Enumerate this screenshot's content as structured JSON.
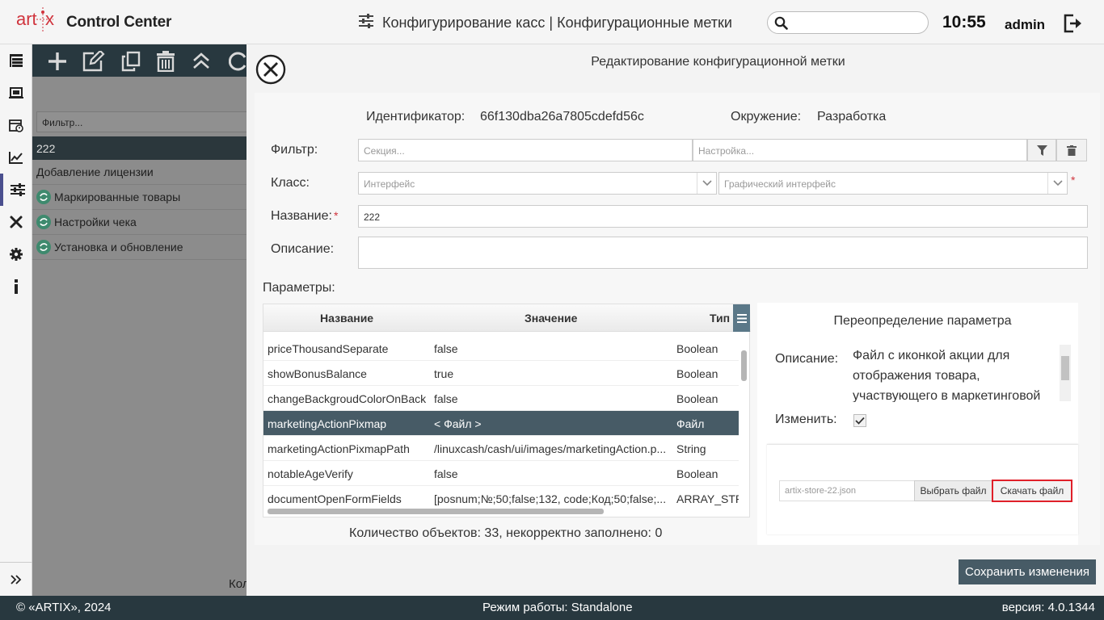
{
  "header": {
    "logo_text": "artix",
    "app_name": "Control Center",
    "title": "Конфигурирование касс | Конфигурационные метки",
    "search_placeholder": "",
    "time": "10:55",
    "user": "admin"
  },
  "rail": {
    "icons": [
      "tree-icon",
      "terminal-icon",
      "schedule-icon",
      "chart-icon",
      "sliders-icon",
      "tools-icon",
      "gear-icon",
      "info-icon"
    ],
    "active_index": 4
  },
  "background_panel": {
    "filter_placeholder": "Фильтр...",
    "selected": "222",
    "items": [
      {
        "label": "Добавление лицензии",
        "sync": false
      },
      {
        "label": "Маркированные товары",
        "sync": true
      },
      {
        "label": "Настройки чека",
        "sync": true
      },
      {
        "label": "Установка и обновление",
        "sync": true
      }
    ],
    "footer_text": "Кол"
  },
  "dialog": {
    "title": "Редактирование конфигурационной метки",
    "id_label": "Идентификатор:",
    "id_value": "66f130dba26a7805cdefd56c",
    "env_label": "Окружение:",
    "env_value": "Разработка",
    "filter_label": "Фильтр:",
    "section_placeholder": "Секция...",
    "setting_placeholder": "Настройка...",
    "class_label": "Класс:",
    "class_value1": "Интерфейс",
    "class_value2": "Графический интерфейс",
    "name_label": "Название:",
    "name_value": "222",
    "desc_label": "Описание:",
    "desc_value": "",
    "params_label": "Параметры:",
    "table": {
      "columns": [
        "Название",
        "Значение",
        "Тип"
      ],
      "rows": [
        {
          "name": "priceThousandSeparate",
          "value": "false",
          "type": "Boolean"
        },
        {
          "name": "showBonusBalance",
          "value": "true",
          "type": "Boolean"
        },
        {
          "name": "changeBackgroudColorOnBack",
          "value": "false",
          "type": "Boolean"
        },
        {
          "name": "marketingActionPixmap",
          "value": "< Файл >",
          "type": "Файл"
        },
        {
          "name": "marketingActionPixmapPath",
          "value": "/linuxcash/cash/ui/images/marketingAction.p...",
          "type": "String"
        },
        {
          "name": "notableAgeVerify",
          "value": "false",
          "type": "Boolean"
        },
        {
          "name": "documentOpenFormFields",
          "value": "[posnum;№;50;false;132, code;Код;50;false;...",
          "type": "ARRAY_STR"
        }
      ],
      "selected_row": 3
    },
    "count_text": "Количество объектов: 33, некорректно заполнено: 0",
    "override": {
      "title": "Переопределение параметра",
      "desc_label": "Описание:",
      "desc_text": "Файл с иконкой акции для отображения товара, участвующего в маркетинговой акции",
      "change_label": "Изменить:",
      "change_checked": true,
      "file_name": "artix-store-22.json",
      "choose_btn": "Выбрать файл",
      "download_btn": "Скачать файл"
    },
    "save_btn": "Сохранить изменения"
  },
  "footer": {
    "copyright": "© «ARTIX», 2024",
    "mode": "Режим работы: Standalone",
    "version": "версия: 4.0.1344"
  }
}
